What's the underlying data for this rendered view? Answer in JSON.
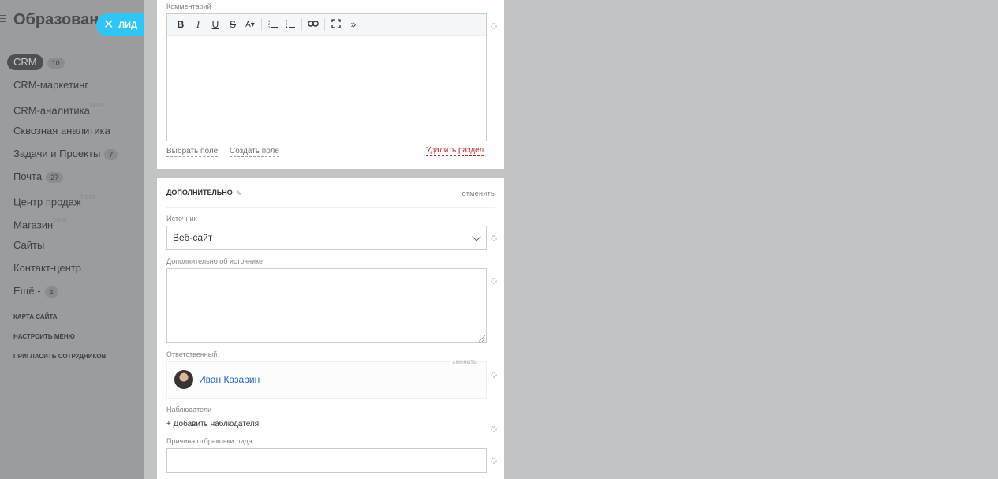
{
  "sidebar": {
    "title": "Образован",
    "lead_tab": "ЛИД",
    "items": [
      {
        "label": "CRM",
        "count": "10",
        "beta": ""
      },
      {
        "label": "CRM-маркетинг",
        "count": "",
        "beta": ""
      },
      {
        "label": "CRM-аналитика",
        "count": "",
        "beta": "beta"
      },
      {
        "label": "Сквозная аналитика",
        "count": "",
        "beta": ""
      },
      {
        "label": "Задачи и Проекты",
        "count": "7",
        "beta": ""
      },
      {
        "label": "Почта",
        "count": "27",
        "beta": ""
      },
      {
        "label": "Центр продаж",
        "count": "",
        "beta": "beta"
      },
      {
        "label": "Магазин",
        "count": "",
        "beta": "beta"
      },
      {
        "label": "Сайты",
        "count": "",
        "beta": ""
      },
      {
        "label": "Контакт-центр",
        "count": "",
        "beta": ""
      },
      {
        "label": "Ещё -",
        "count": "4",
        "beta": ""
      }
    ],
    "links": [
      "КАРТА САЙТА",
      "НАСТРОИТЬ МЕНЮ",
      "ПРИГЛАСИТЬ СОТРУДНИКОВ"
    ]
  },
  "comment_section": {
    "label": "Комментарий",
    "toolbar": [
      "B",
      "I",
      "U",
      "S",
      "A▾",
      "list-ordered-icon",
      "list-bullet-icon",
      "link-icon",
      "fullscreen-icon",
      "»"
    ],
    "select_field": "Выбрать поле",
    "create_field": "Создать поле",
    "delete_section": "Удалить раздел"
  },
  "additional_section": {
    "title": "ДОПОЛНИТЕЛЬНО",
    "cancel": "отменить",
    "source_label": "Источник",
    "source_value": "Веб-сайт",
    "source_extra_label": "Дополнительно об источнике",
    "responsible_label": "Ответственный",
    "responsible_change": "сменить",
    "responsible_name": "Иван Казарин",
    "observers_label": "Наблюдатели",
    "add_observer": "+ Добавить наблюдателя",
    "reject_reason_label": "Причина отбраковки лида"
  },
  "colors": {
    "accent": "#2fc6f6",
    "link_blue": "#2066b0",
    "danger": "#b12d2d",
    "overlay": "#c1c5c6"
  }
}
